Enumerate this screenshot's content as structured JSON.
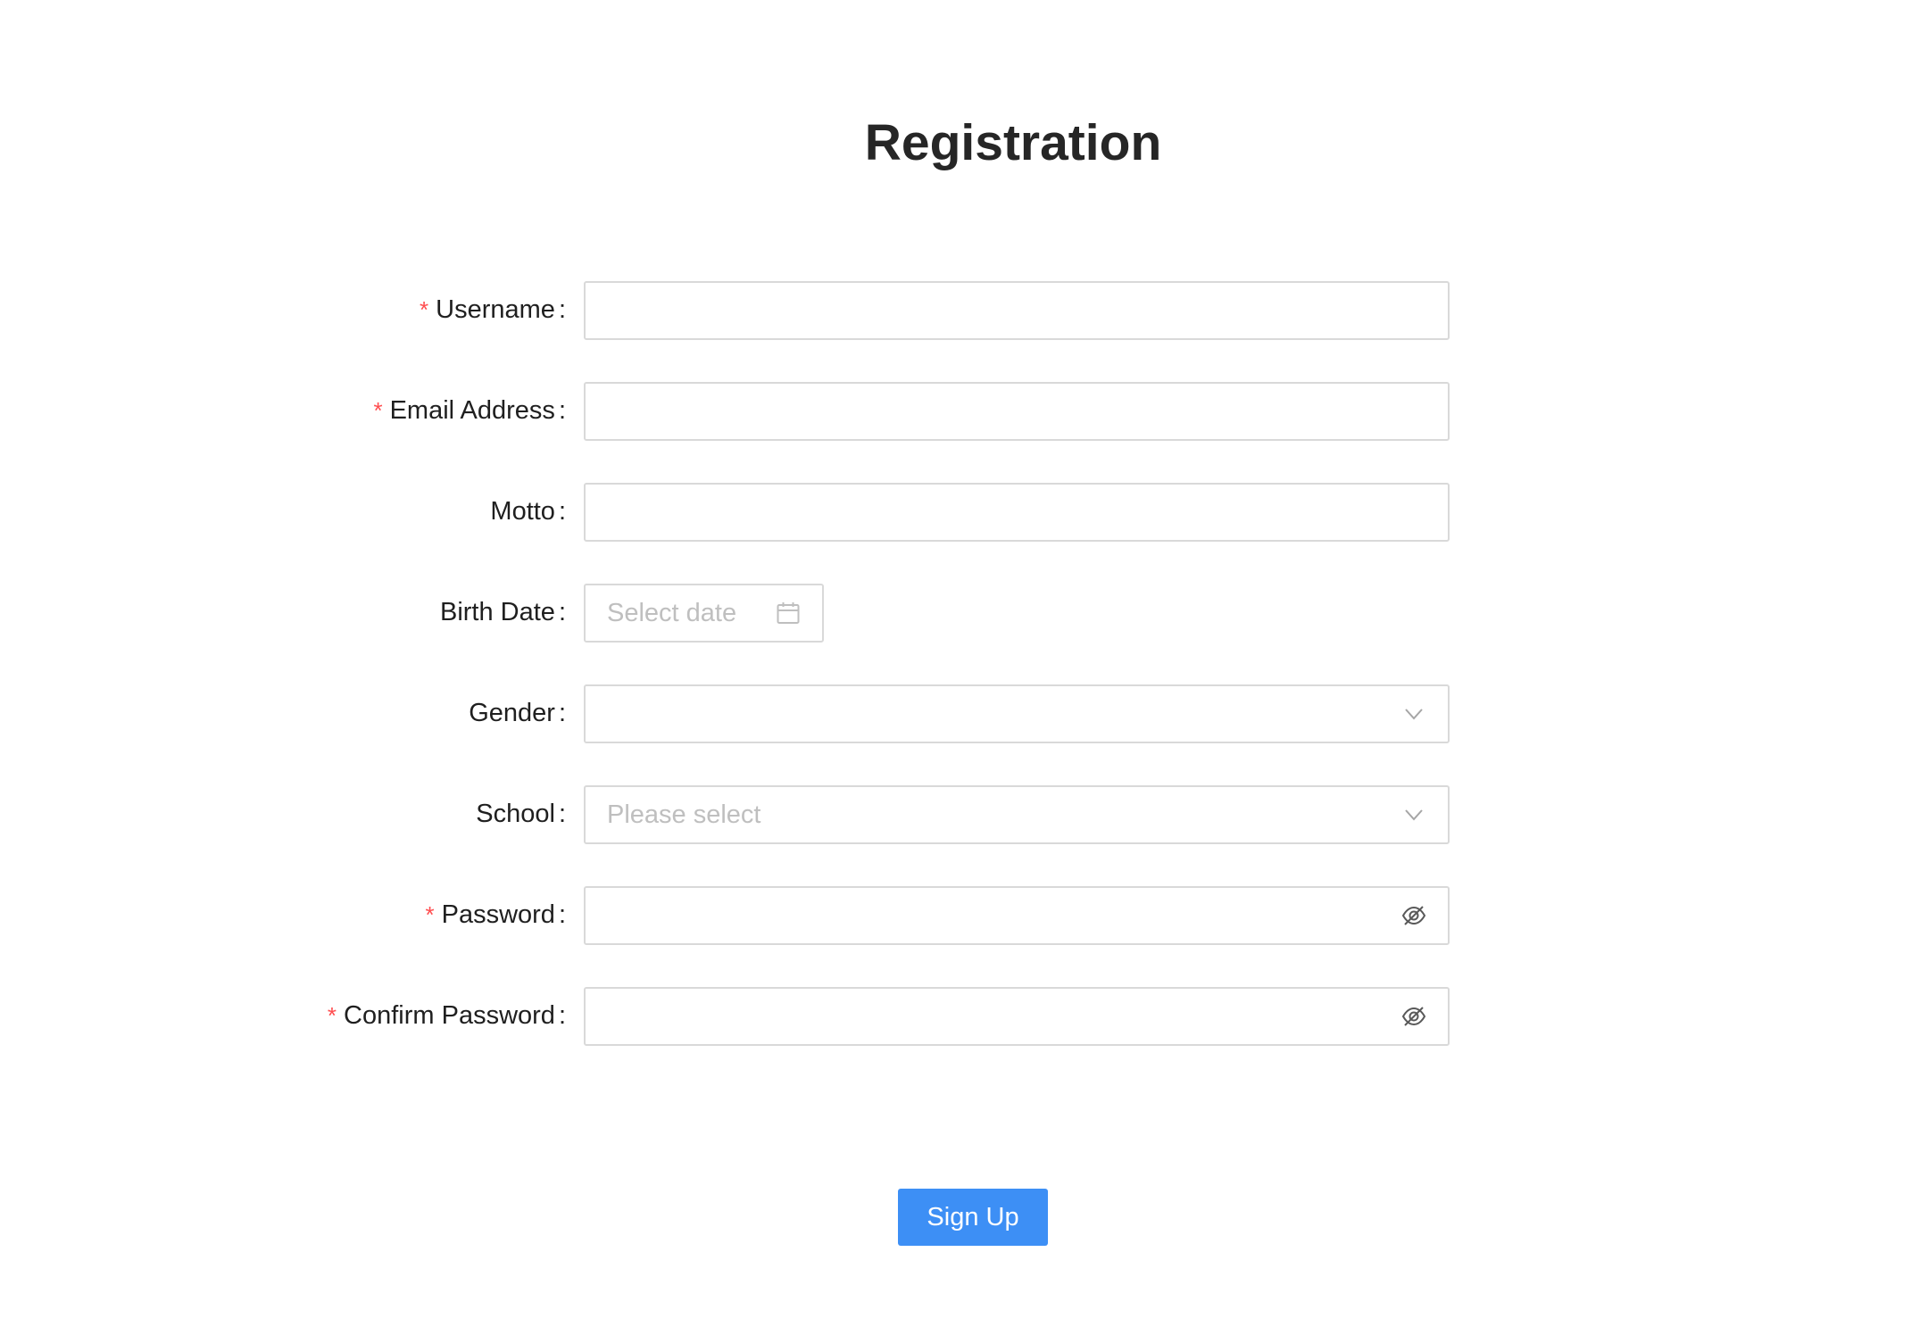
{
  "page": {
    "title": "Registration"
  },
  "form": {
    "fields": [
      {
        "label": "Username",
        "required": true,
        "value": "",
        "placeholder": ""
      },
      {
        "label": "Email Address",
        "required": true,
        "value": "",
        "placeholder": ""
      },
      {
        "label": "Motto",
        "required": false,
        "value": "",
        "placeholder": ""
      },
      {
        "label": "Birth Date",
        "required": false,
        "value": "",
        "placeholder": "Select date",
        "icon": "calendar-icon"
      },
      {
        "label": "Gender",
        "required": false,
        "value": "",
        "placeholder": "",
        "icon": "chevron-down-icon"
      },
      {
        "label": "School",
        "required": false,
        "value": "",
        "placeholder": "Please select",
        "icon": "chevron-down-icon"
      },
      {
        "label": "Password",
        "required": true,
        "value": "",
        "placeholder": "",
        "icon": "eye-invisible-icon"
      },
      {
        "label": "Confirm Password",
        "required": true,
        "value": "",
        "placeholder": "",
        "icon": "eye-invisible-icon"
      }
    ],
    "required_mark": "*",
    "colon": ":",
    "submit_label": "Sign Up"
  },
  "colors": {
    "primary": "#3d8ff5",
    "required": "#ff4d4f",
    "border": "#d9d9d9",
    "placeholder": "#bfbfbf"
  }
}
